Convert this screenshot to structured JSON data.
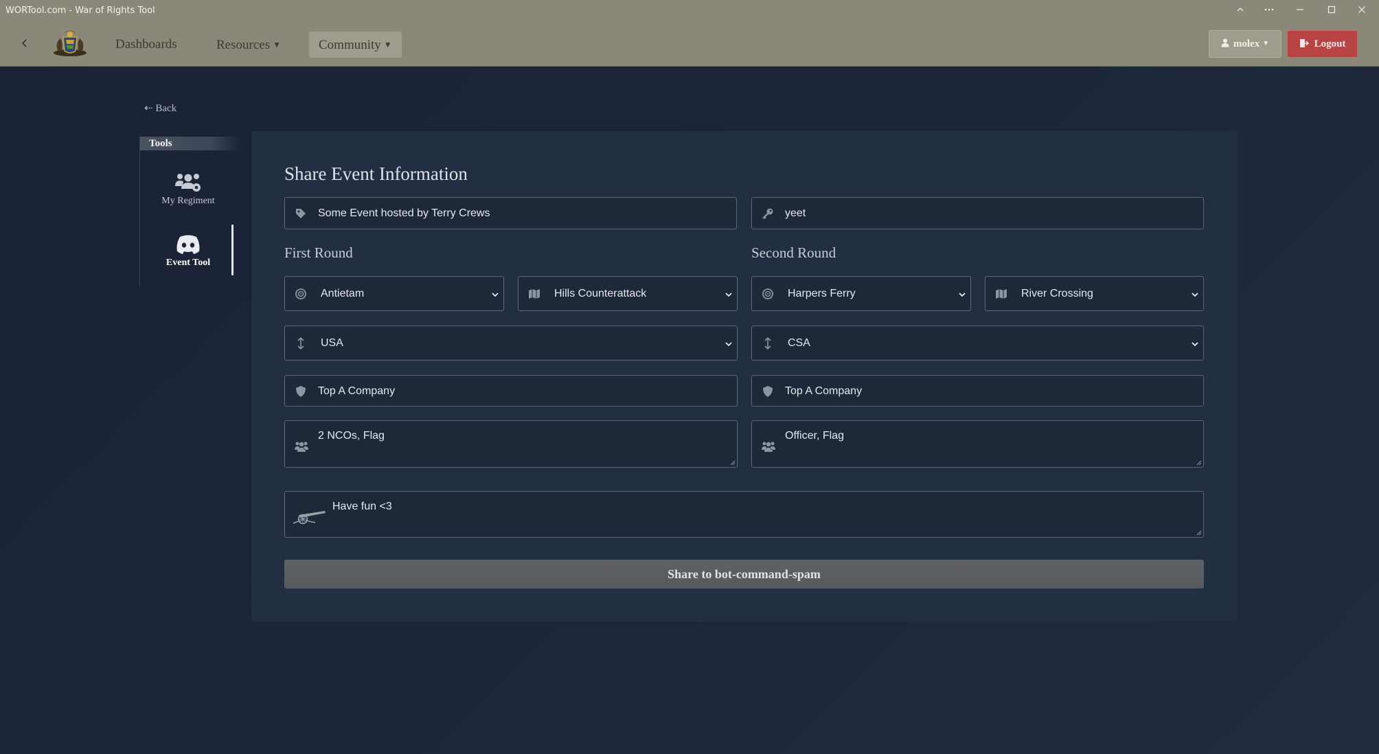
{
  "window": {
    "title": "WORTool.com - War of Rights Tool"
  },
  "nav": {
    "links": [
      {
        "label": "Dashboards"
      },
      {
        "label": "Resources"
      },
      {
        "label": "Community"
      }
    ],
    "user_label": "molex",
    "logout_label": "Logout"
  },
  "back_label": "Back",
  "sidebar": {
    "heading": "Tools",
    "items": [
      {
        "label": "My Regiment",
        "icon": "users-cog-icon"
      },
      {
        "label": "Event Tool",
        "icon": "discord-icon"
      }
    ]
  },
  "form": {
    "title": "Share Event Information",
    "event_name": "Some Event hosted by Terry Crews",
    "password": "yeet",
    "first_round": {
      "title": "First Round",
      "map": "Antietam",
      "mode": "Hills Counterattack",
      "faction": "USA",
      "company": "Top A Company",
      "roles": "2 NCOs, Flag"
    },
    "second_round": {
      "title": "Second Round",
      "map": "Harpers Ferry",
      "mode": "River Crossing",
      "faction": "CSA",
      "company": "Top A Company",
      "roles": "Officer, Flag"
    },
    "message": "Have fun <3",
    "submit_label": "Share to bot-command-spam"
  },
  "colors": {
    "navbar": "#8a8878",
    "background": "#1c2638",
    "card": "#222e41",
    "logout": "#b74443"
  }
}
